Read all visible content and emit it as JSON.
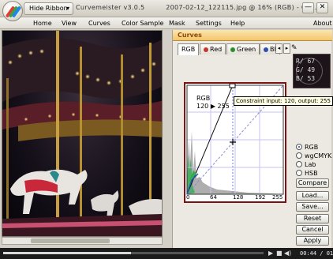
{
  "titlebar": {
    "hide_ribbon": "Hide Ribbon",
    "app_name": "Curvemeister v3.0.5",
    "doc_info": "2007-02-12_122115.jpg @ 16% (RGB) - Cu...",
    "minimize": "—",
    "close": "✕"
  },
  "menu": {
    "items": [
      "Home",
      "View",
      "Curves",
      "Color Sample",
      "Mask",
      "Settings",
      "Help"
    ],
    "about": "About"
  },
  "panel": {
    "title": "Curves",
    "tabs": [
      "RGB",
      "Red",
      "Green",
      "Bl"
    ],
    "tab_colors": [
      "#c0392b",
      "#2e8b2e",
      "#2b4fb3"
    ],
    "readout": {
      "r": "R/ 67",
      "g": "G/ 49",
      "b": "B/ 53"
    },
    "curve": {
      "channel_label": "RGB",
      "input_value": "120",
      "output_value": "255",
      "tooltip": "Constraint input: 120, output: 255",
      "x_ticks": [
        "0",
        "64",
        "128",
        "192",
        "255"
      ]
    },
    "color_modes": [
      "RGB",
      "wgCMYK",
      "Lab",
      "HSB"
    ],
    "selected_mode": "RGB",
    "buttons": [
      "Compare",
      "Load...",
      "Save...",
      "Reset",
      "Cancel",
      "Apply"
    ]
  },
  "player": {
    "time": "00:44 / 01:29",
    "progress": 0.49
  },
  "colors": {
    "panel_header": "#f4c56a",
    "curve_border": "#7a1414",
    "tooltip_bg": "#ffffe1"
  }
}
